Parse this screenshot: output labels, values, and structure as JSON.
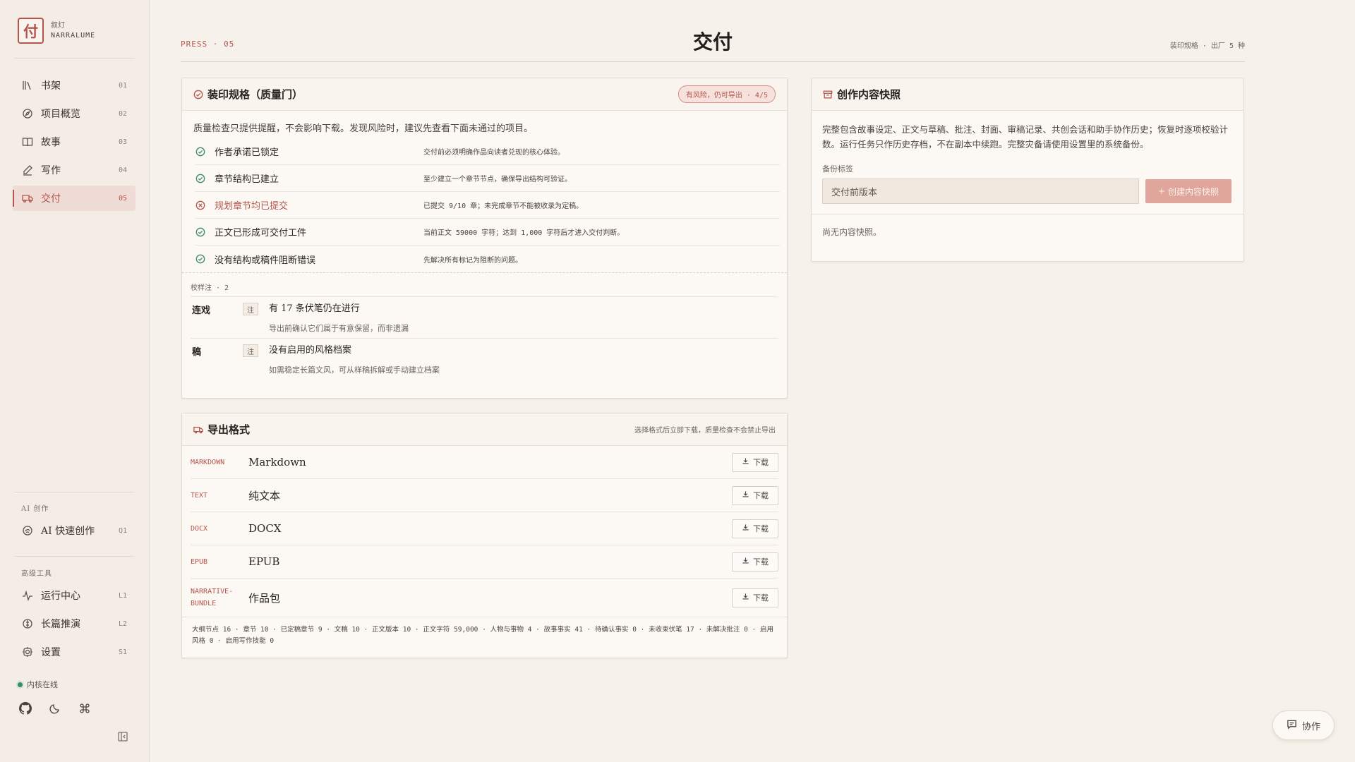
{
  "brand": {
    "logo_char": "付",
    "cn": "叙灯",
    "en": "NARRALUME"
  },
  "nav": [
    {
      "icon": "books-icon",
      "label": "书架",
      "code": "01"
    },
    {
      "icon": "compass-icon",
      "label": "项目概览",
      "code": "02"
    },
    {
      "icon": "book-open-icon",
      "label": "故事",
      "code": "03"
    },
    {
      "icon": "pen-icon",
      "label": "写作",
      "code": "04"
    },
    {
      "icon": "truck-icon",
      "label": "交付",
      "code": "05",
      "active": true
    }
  ],
  "ai_section": {
    "title": "AI 创作",
    "items": [
      {
        "icon": "spark-icon",
        "label": "AI 快速创作",
        "code": "Q1"
      }
    ]
  },
  "tools_section": {
    "title": "高级工具",
    "items": [
      {
        "icon": "activity-icon",
        "label": "运行中心",
        "code": "L1"
      },
      {
        "icon": "compass-icon",
        "label": "长篇推演",
        "code": "L2"
      },
      {
        "icon": "gear-icon",
        "label": "设置",
        "code": "S1"
      }
    ]
  },
  "kernel_status": "内核在线",
  "header": {
    "press": "PRESS · 05",
    "title": "交付",
    "meta": "装印规格 · 出厂 5 种"
  },
  "quality_gate": {
    "title": "装印规格（质量门）",
    "badge": "有风险，仍可导出 · 4/5",
    "intro": "质量检查只提供提醒，不会影响下载。发现风险时，建议先查看下面未通过的项目。",
    "checks": [
      {
        "name": "作者承诺已锁定",
        "desc": "交付前必须明确作品向读者兑现的核心体验。",
        "status": "pass"
      },
      {
        "name": "章节结构已建立",
        "desc": "至少建立一个章节节点，确保导出结构可验证。",
        "status": "pass"
      },
      {
        "name": "规划章节均已提交",
        "desc": "已提交 9/10 章；未完成章节不能被收录为定稿。",
        "status": "fail"
      },
      {
        "name": "正文已形成可交付工件",
        "desc": "当前正文 59000 字符；达到 1,000 字符后才进入交付判断。",
        "status": "pass"
      },
      {
        "name": "没有结构或稿件阻断错误",
        "desc": "先解决所有标记为阻断的问题。",
        "status": "pass"
      }
    ],
    "notes_title": "校样注 · 2",
    "notes": [
      {
        "tag": "连戏",
        "chip": "注",
        "text": "有 17 条伏笔仍在进行",
        "sub": "导出前确认它们属于有意保留，而非遗漏"
      },
      {
        "tag": "稿",
        "chip": "注",
        "text": "没有启用的风格档案",
        "sub": "如需稳定长篇文风，可从样稿拆解或手动建立档案"
      }
    ]
  },
  "export": {
    "title": "导出格式",
    "note": "选择格式后立即下载，质量检查不会禁止导出",
    "download_label": "下载",
    "formats": [
      {
        "code": "MARKDOWN",
        "name": "Markdown"
      },
      {
        "code": "TEXT",
        "name": "纯文本"
      },
      {
        "code": "DOCX",
        "name": "DOCX"
      },
      {
        "code": "EPUB",
        "name": "EPUB"
      },
      {
        "code": "NARRATIVE-BUNDLE",
        "code_line1": "NARRATIVE-",
        "code_line2": "BUNDLE",
        "name": "作品包"
      }
    ],
    "stats": "大纲节点 16 · 章节 10 · 已定稿章节 9 · 文稿 10 · 正文版本 10 · 正文字符 59,000 · 人物与事物 4 · 故事事实 41 · 待确认事实 0 · 未收束伏笔 17 · 未解决批注 0 · 启用风格 0 · 启用写作技能 0"
  },
  "snapshot": {
    "title": "创作内容快照",
    "desc": "完整包含故事设定、正文与草稿、批注、封面、审稿记录、共创会话和助手协作历史；恢复时逐项校验计数。运行任务只作历史存档，不在副本中续跑。完整灾备请使用设置里的系统备份。",
    "label": "备份标签",
    "input_value": "交付前版本",
    "button": "创建内容快照",
    "empty": "尚无内容快照。"
  },
  "collab_label": "协作",
  "colors": {
    "accent": "#b5544c",
    "pass": "#3f8a63",
    "background": "#f6f1ea"
  }
}
